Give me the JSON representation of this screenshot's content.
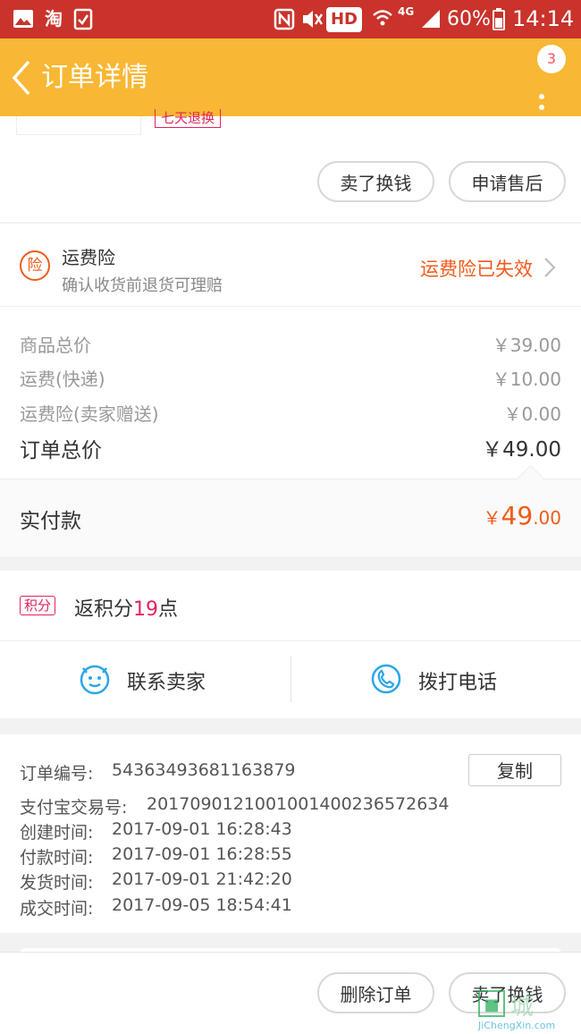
{
  "status_bar": {
    "carrier_icon_text": "淘",
    "signal_label": "4G",
    "hd_label": "HD",
    "battery": "60%",
    "time": "14:14"
  },
  "nav": {
    "title": "订单详情",
    "badge_count": "3"
  },
  "product_partial": {
    "tag": "七天退换"
  },
  "top_actions": {
    "sell_label": "卖了换钱",
    "after_sale_label": "申请售后"
  },
  "insurance": {
    "icon_char": "险",
    "title": "运费险",
    "subtitle": "确认收货前退货可理赔",
    "status": "运费险已失效"
  },
  "price": {
    "rows": [
      {
        "label": "商品总价",
        "value": "￥39.00"
      },
      {
        "label": "运费(快递)",
        "value": "￥10.00"
      },
      {
        "label": "运费险(卖家赠送)",
        "value": "￥0.00"
      }
    ],
    "total_label": "订单总价",
    "total_value": "￥49.00",
    "paid_label": "实付款",
    "paid_symbol": "￥",
    "paid_int": "49",
    "paid_dec": ".00"
  },
  "points": {
    "tag": "积分",
    "prefix": "返积分",
    "number": "19",
    "suffix": "点"
  },
  "contact": {
    "seller_label": "联系卖家",
    "call_label": "拨打电话"
  },
  "order_info": {
    "copy_label": "复制",
    "rows": [
      {
        "label": "订单编号:",
        "value": "54363493681163879"
      },
      {
        "label": "支付宝交易号:",
        "value": "2017090121001001400236572634"
      },
      {
        "label": "创建时间:",
        "value": "2017-09-01 16:28:43"
      },
      {
        "label": "付款时间:",
        "value": "2017-09-01 16:28:55"
      },
      {
        "label": "发货时间:",
        "value": "2017-09-01 21:42:20"
      },
      {
        "label": "成交时间:",
        "value": "2017-09-05 18:54:41"
      }
    ]
  },
  "bottom_actions": {
    "delete_label": "删除订单",
    "sell_label": "卖了换钱"
  },
  "watermark": {
    "brand": "城",
    "site": "JiChengXin.com"
  },
  "colors": {
    "status_bar": "#c9332b",
    "nav_bar": "#f8b734",
    "accent_orange": "#f05a1a",
    "points_red": "#e0245e",
    "icon_blue": "#2aa6e8"
  }
}
